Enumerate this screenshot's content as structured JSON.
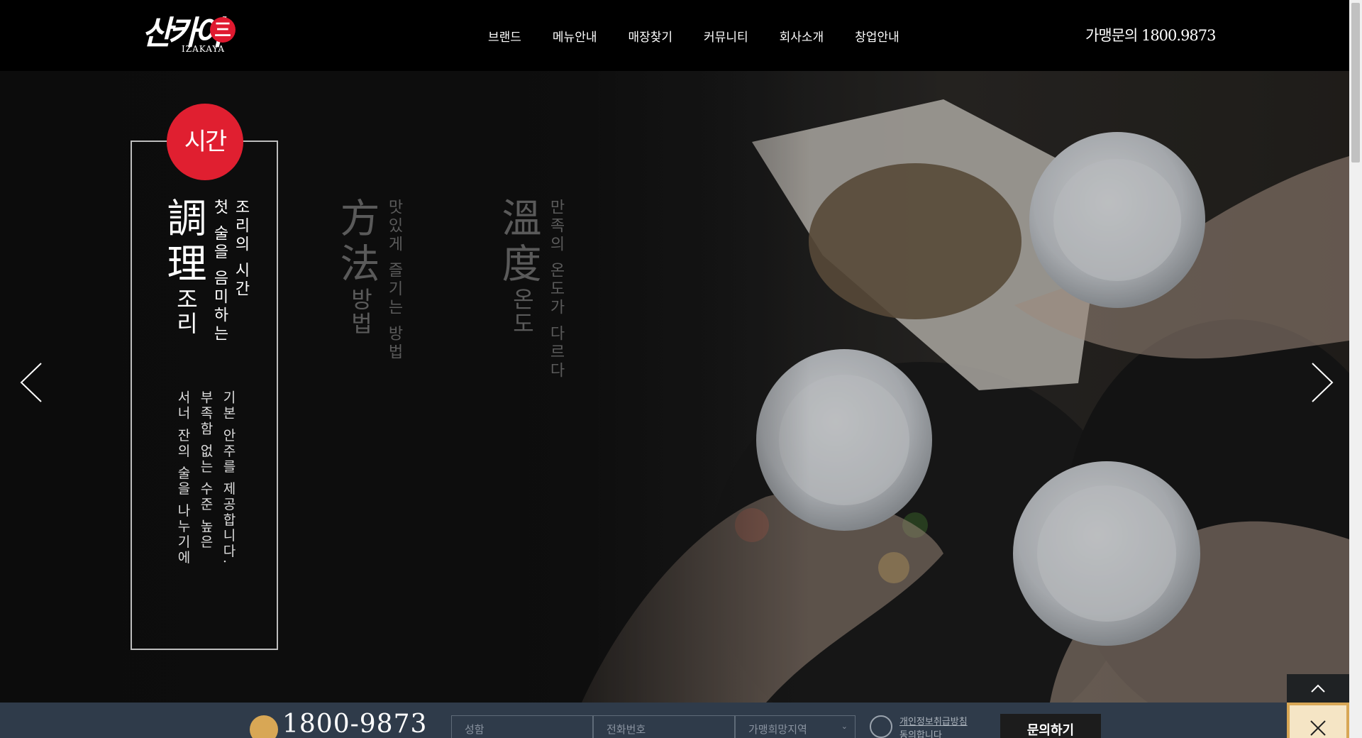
{
  "header": {
    "logo_main": "산카이",
    "logo_badge": "三",
    "logo_sub": "IZAKAYA",
    "nav": [
      "브랜드",
      "메뉴안내",
      "매장찾기",
      "커뮤니티",
      "회사소개",
      "창업안내"
    ],
    "hotline": "가맹문의 1800.9873"
  },
  "hero": {
    "active_badge": "시간",
    "active_hanja": "調理",
    "active_sub": "조리",
    "active_tag_line1": "조리의 시간",
    "active_tag_line2": "첫 술을 음미하는",
    "description": [
      "기본 안주를 제공합니다.",
      "부족함 없는 수준 높은",
      "서너 잔의 술을 나누기에"
    ],
    "panel2_hanja": "方法",
    "panel2_sub": "방법",
    "panel2_tag": "맛있게 즐기는 방법",
    "panel3_hanja": "溫度",
    "panel3_sub": "온도",
    "panel3_tag": "만족의 온도가 다르다"
  },
  "bottom": {
    "phone": "1800-9873",
    "name_placeholder": "성함",
    "tel_placeholder": "전화번호",
    "region_placeholder": "가맹희망지역",
    "privacy": "개인정보취급방침",
    "privacy_line2": "동의합니다",
    "submit": "문의하기"
  },
  "colors": {
    "accent_red": "#e01f30",
    "bar_navy": "#2f3b4a",
    "gold": "#d8a755"
  }
}
